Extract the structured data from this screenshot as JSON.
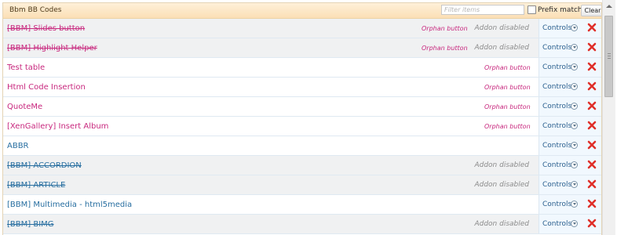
{
  "header": {
    "title": "Bbm BB Codes",
    "filter_placeholder": "Filter items",
    "prefix_match_label": "Prefix match",
    "clear_label": "Clear"
  },
  "labels": {
    "orphan": "Orphan button",
    "addon_disabled": "Addon disabled",
    "controls": "Controls"
  },
  "colors": {
    "orphan_name": "#c8287e",
    "regular_name": "#276ea0",
    "header_bg": "#fde7c4",
    "disabled_row_bg": "#f0f1f2",
    "delete_icon": "#e0302a"
  },
  "rows": [
    {
      "name": "[BBM] Slides button",
      "orphan": true,
      "disabled": true
    },
    {
      "name": "[BBM] Highlight Helper",
      "orphan": true,
      "disabled": true
    },
    {
      "name": "Test table",
      "orphan": true,
      "disabled": false
    },
    {
      "name": "Html Code Insertion",
      "orphan": true,
      "disabled": false
    },
    {
      "name": "QuoteMe",
      "orphan": true,
      "disabled": false
    },
    {
      "name": "[XenGallery] Insert Album",
      "orphan": true,
      "disabled": false
    },
    {
      "name": "ABBR",
      "orphan": false,
      "disabled": false
    },
    {
      "name": "[BBM] ACCORDION",
      "orphan": false,
      "disabled": true
    },
    {
      "name": "[BBM] ARTICLE",
      "orphan": false,
      "disabled": true
    },
    {
      "name": "[BBM] Multimedia - html5media",
      "orphan": false,
      "disabled": false
    },
    {
      "name": "[BBM] BIMG",
      "orphan": false,
      "disabled": true
    }
  ],
  "icons": {
    "controls_menu": "chevron-down-circle-icon",
    "delete": "red-x-delete-icon",
    "scroll_up": "arrow-up-icon"
  }
}
